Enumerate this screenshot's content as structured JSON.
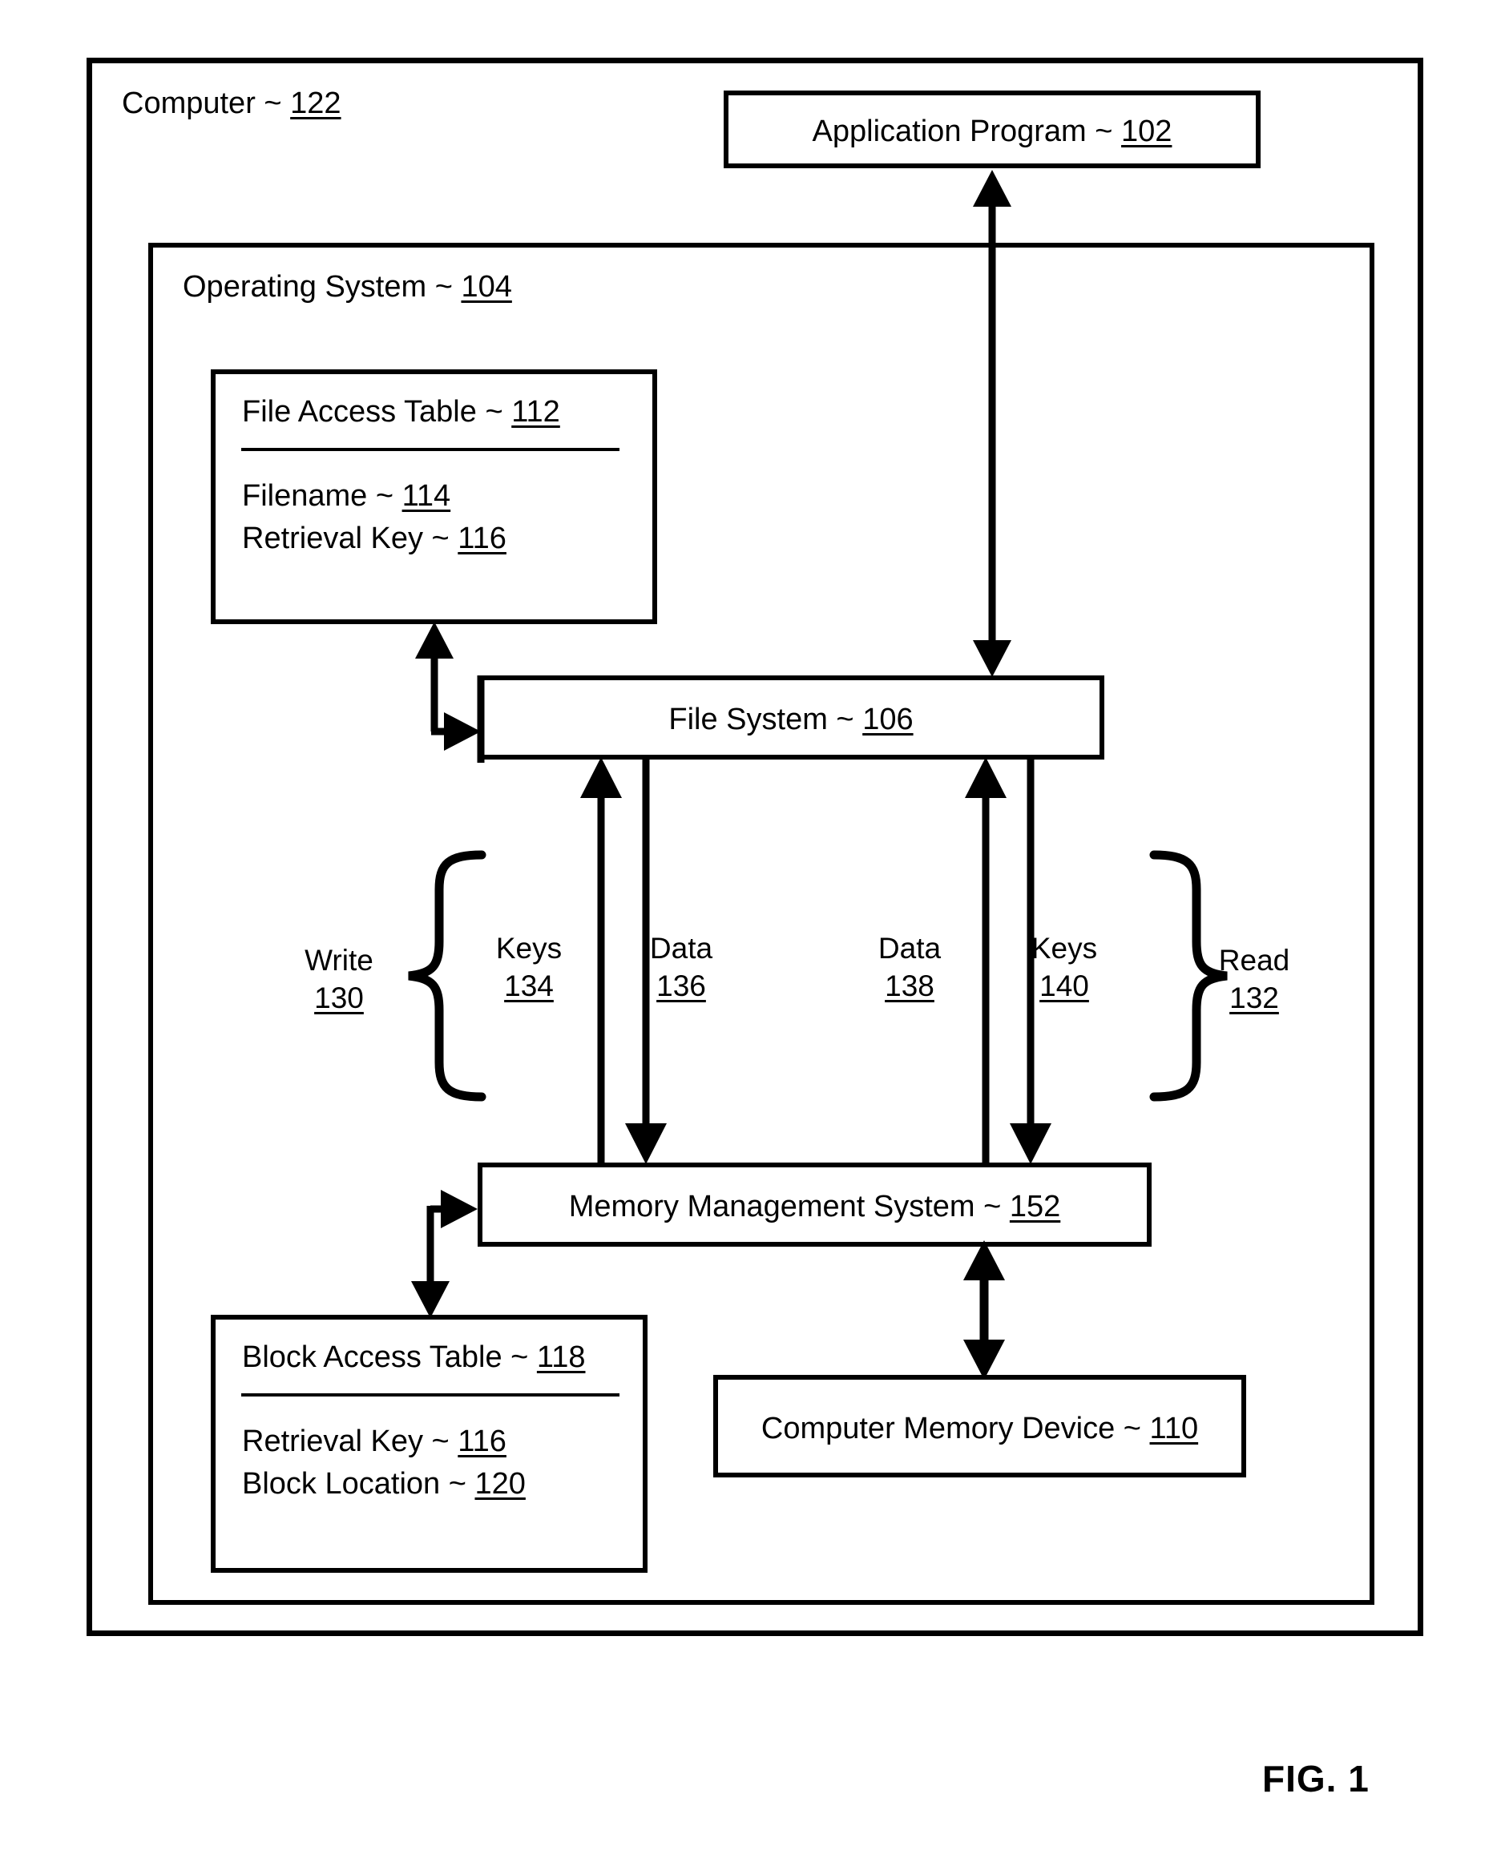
{
  "figure": {
    "caption": "FIG. 1"
  },
  "containers": {
    "computer": {
      "label": "Computer ~ ",
      "ref": "122"
    },
    "operating_system": {
      "label": "Operating System ~ ",
      "ref": "104"
    }
  },
  "boxes": {
    "application_program": {
      "label": "Application Program ~ ",
      "ref": "102"
    },
    "file_system": {
      "label": "File System ~ ",
      "ref": "106"
    },
    "memory_management_system": {
      "label": "Memory Management System ~ ",
      "ref": "152"
    },
    "computer_memory_device": {
      "label": "Computer Memory Device ~ ",
      "ref": "110"
    },
    "file_access_table": {
      "title": "File Access Table ~ ",
      "ref": "112",
      "rows": [
        {
          "label": "Filename ~ ",
          "ref": "114"
        },
        {
          "label": "Retrieval Key ~ ",
          "ref": "116"
        }
      ]
    },
    "block_access_table": {
      "title": "Block Access Table ~ ",
      "ref": "118",
      "rows": [
        {
          "label": "Retrieval Key ~ ",
          "ref": "116"
        },
        {
          "label": "Block Location ~ ",
          "ref": "120"
        }
      ]
    }
  },
  "flows": {
    "write": {
      "label": "Write",
      "ref": "130"
    },
    "read": {
      "label": "Read",
      "ref": "132"
    },
    "keys_134": {
      "label": "Keys",
      "ref": "134"
    },
    "data_136": {
      "label": "Data",
      "ref": "136"
    },
    "data_138": {
      "label": "Data",
      "ref": "138"
    },
    "keys_140": {
      "label": "Keys",
      "ref": "140"
    }
  },
  "colors": {
    "ink": "#000000",
    "paper": "#ffffff"
  }
}
